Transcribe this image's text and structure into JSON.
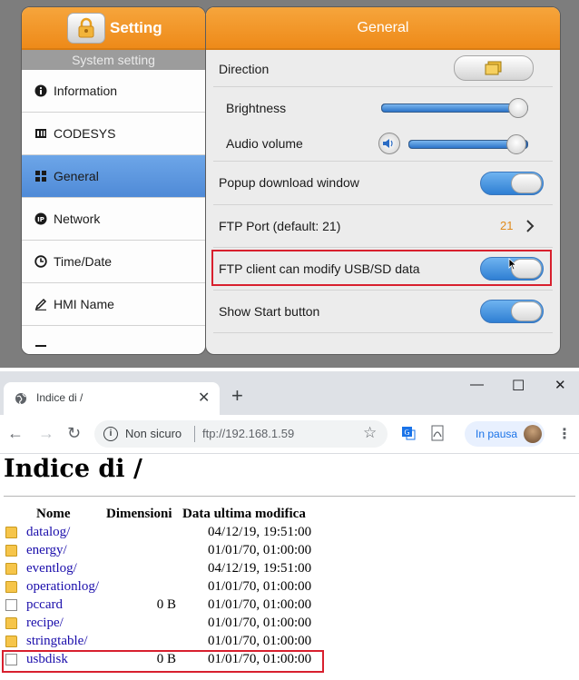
{
  "hmi": {
    "left_title": "Setting",
    "left_subtitle": "System setting",
    "menu": [
      {
        "label": "Information",
        "icon": "info-icon"
      },
      {
        "label": "CODESYS",
        "icon": "codesys-icon"
      },
      {
        "label": "General",
        "icon": "grid-icon",
        "active": true
      },
      {
        "label": "Network",
        "icon": "network-icon"
      },
      {
        "label": "Time/Date",
        "icon": "clock-icon"
      },
      {
        "label": "HMI Name",
        "icon": "pen-icon"
      }
    ],
    "right_title": "General",
    "direction_label": "Direction",
    "brightness_label": "Brightness",
    "brightness_level": 0.93,
    "audio_label": "Audio volume",
    "audio_level": 0.9,
    "popup_label": "Popup download window",
    "ftp_port_label": "FTP Port  (default: 21)",
    "ftp_port_value": "21",
    "ftp_modify_label": "FTP client can modify USB/SD data",
    "start_button_label": "Show Start button",
    "accent_color": "#ee8a19",
    "highlight_color": "#d8202e"
  },
  "browser": {
    "tab_title": "Indice di /",
    "tab_close": "✕",
    "new_tab": "+",
    "window_controls": [
      "—",
      "☐",
      "✕"
    ],
    "nav": {
      "back": "←",
      "forward": "→",
      "reload": "↻"
    },
    "not_secure": "Non sicuro",
    "url": "ftp://192.168.1.59",
    "star": "☆",
    "paused_label": "In pausa",
    "menu_dots": "⋮"
  },
  "page": {
    "heading": "Indice di /",
    "columns": {
      "name": "Nome",
      "size": "Dimensioni",
      "date": "Data ultima modifica"
    },
    "files": [
      {
        "name": "datalog/",
        "size": "",
        "date": "04/12/19, 19:51:00",
        "type": "folder"
      },
      {
        "name": "energy/",
        "size": "",
        "date": "01/01/70, 01:00:00",
        "type": "folder"
      },
      {
        "name": "eventlog/",
        "size": "",
        "date": "04/12/19, 19:51:00",
        "type": "folder"
      },
      {
        "name": "operationlog/",
        "size": "",
        "date": "01/01/70, 01:00:00",
        "type": "folder"
      },
      {
        "name": "pccard",
        "size": "0 B",
        "date": "01/01/70, 01:00:00",
        "type": "file"
      },
      {
        "name": "recipe/",
        "size": "",
        "date": "01/01/70, 01:00:00",
        "type": "folder"
      },
      {
        "name": "stringtable/",
        "size": "",
        "date": "01/01/70, 01:00:00",
        "type": "folder"
      },
      {
        "name": "usbdisk",
        "size": "0 B",
        "date": "01/01/70, 01:00:00",
        "type": "file",
        "highlighted": true
      }
    ]
  }
}
